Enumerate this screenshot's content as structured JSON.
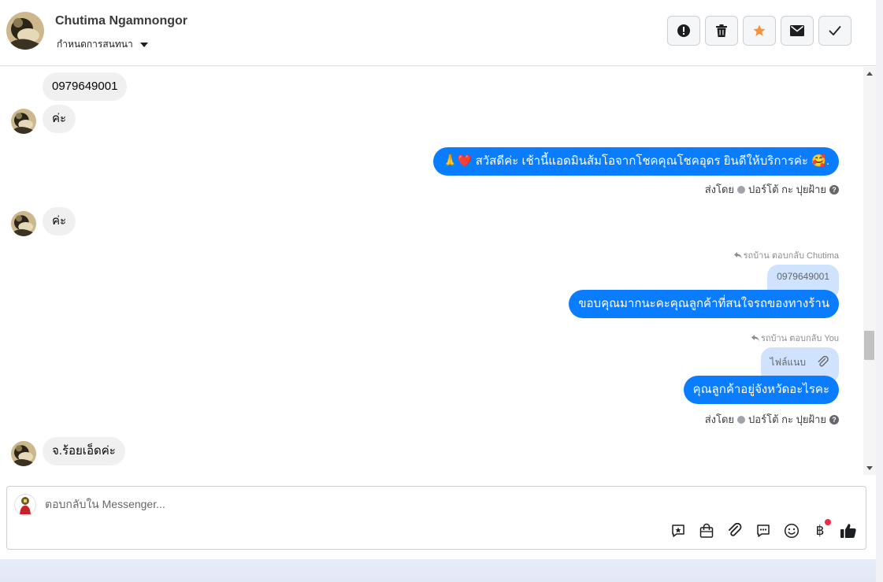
{
  "header": {
    "contact_name": "Chutima Ngamnongor",
    "assign_label": "กำหนดการสนทนา",
    "actions": [
      {
        "name": "report-spam-button",
        "icon": "alert-icon"
      },
      {
        "name": "delete-button",
        "icon": "trash-icon"
      },
      {
        "name": "star-button",
        "icon": "star-icon",
        "color": "#f7923a"
      },
      {
        "name": "mark-unread-button",
        "icon": "envelope-icon"
      },
      {
        "name": "mark-done-button",
        "icon": "check-icon"
      }
    ]
  },
  "messages": {
    "m1_text": "0979649001",
    "m2_text": "ค่ะ",
    "m3_text": "สวัสดีค่ะ เช้านี้แอดมินส้มโอจากโชคคุณโชคอุดร ยินดีให้บริการค่ะ",
    "m3_emoji_left": "🙏❤️",
    "m3_emoji_right": "🥰.",
    "m3_meta_sent_by": "ส่งโดย",
    "m3_meta_sender": "ปอร์โต้ กะ ปุยฝ้าย",
    "m4_text": "ค่ะ",
    "m5_reply_meta": "รถบ้าน ตอบกลับ Chutima",
    "m5_quote": "0979649001",
    "m5_text": "ขอบคุณมากนะคะคุณลูกค้าที่สนใจรถของทางร้าน",
    "m6_reply_meta": "รถบ้าน ตอบกลับ You",
    "m6_quote": "ไฟล์แนบ",
    "m6_text": "คุณลูกค้าอยู่จังหวัดอะไรคะ",
    "m6_meta_sent_by": "ส่งโดย",
    "m6_meta_sender": "ปอร์โต้ กะ ปุยฝ้าย",
    "m7_text": "จ.ร้อยเอ็ดค่ะ"
  },
  "composer": {
    "placeholder": "ตอบกลับใน Messenger...",
    "tools": [
      "saved-replies-icon",
      "shop-bag-icon",
      "paperclip-icon",
      "chat-bubble-icon",
      "emoji-icon",
      "baht-icon",
      "thumbs-up-icon"
    ],
    "baht_symbol": "฿"
  },
  "colors": {
    "outgoing": "#0a7cff",
    "incoming": "#f0f0f0",
    "quote": "#cfe3ff",
    "star": "#f7923a",
    "badge": "#f02849"
  }
}
